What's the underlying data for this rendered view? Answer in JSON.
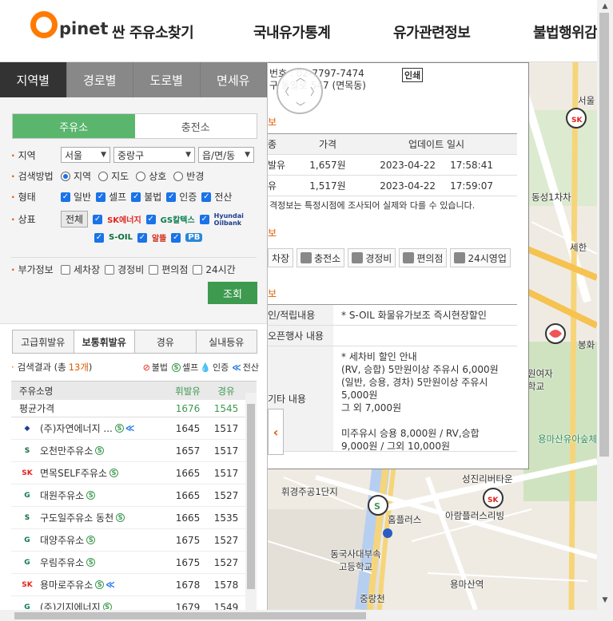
{
  "header": {
    "logo_letter": "O",
    "logo_text": "pinet",
    "nav": [
      "싼 주유소찾기",
      "국내유가통계",
      "유가관련정보",
      "불법행위감"
    ]
  },
  "sidebar": {
    "main_tabs": [
      "지역별",
      "경로별",
      "도로별",
      "면세유"
    ],
    "type_tabs": [
      "주유소",
      "충전소"
    ],
    "filters": {
      "region_label": "지역",
      "region_sido": "서울",
      "region_gu": "중랑구",
      "region_dong": "읍/면/동",
      "method_label": "검색방법",
      "methods": [
        "지역",
        "지도",
        "상호",
        "반경"
      ],
      "form_label": "형태",
      "forms": [
        "일반",
        "셀프",
        "불법",
        "인증",
        "전산"
      ],
      "brand_label": "상표",
      "brand_all": "전체",
      "brands": [
        "SK에너지",
        "GS칼텍스",
        "Hyundai Oilbank",
        "S-OIL",
        "알뜰",
        "PB"
      ],
      "extra_label": "부가정보",
      "extras": [
        "세차장",
        "경정비",
        "편의점",
        "24시간"
      ],
      "search_button": "조회"
    },
    "fuel_tabs": [
      "고급휘발유",
      "보통휘발유",
      "경유",
      "실내등유"
    ],
    "result": {
      "prefix": "검색결과 (총",
      "count": "13개",
      "suffix": ")",
      "legend": [
        "불법",
        "셀프",
        "인증",
        "전산"
      ]
    },
    "list": {
      "headers": [
        "주유소명",
        "휘발유",
        "경유"
      ],
      "average": {
        "name": "평균가격",
        "gasoline": "1676",
        "diesel": "1545"
      },
      "rows": [
        {
          "name": "(주)자연에너지 ...",
          "brand": "hyundai",
          "gasoline": "1645",
          "diesel": "1517"
        },
        {
          "name": "오천만주유소",
          "brand": "soil",
          "gasoline": "1657",
          "diesel": "1517"
        },
        {
          "name": "면목SELF주유소",
          "brand": "sk",
          "gasoline": "1665",
          "diesel": "1517"
        },
        {
          "name": "대원주유소",
          "brand": "gs",
          "gasoline": "1665",
          "diesel": "1527"
        },
        {
          "name": "구도일주유소 동천",
          "brand": "soil",
          "gasoline": "1665",
          "diesel": "1535"
        },
        {
          "name": "대양주유소",
          "brand": "gs",
          "gasoline": "1675",
          "diesel": "1527"
        },
        {
          "name": "우림주유소",
          "brand": "gs",
          "gasoline": "1675",
          "diesel": "1527"
        },
        {
          "name": "용마로주유소",
          "brand": "sk",
          "gasoline": "1678",
          "diesel": "1578"
        },
        {
          "name": "(주)기지에너지",
          "brand": "gs",
          "gasoline": "1679",
          "diesel": "1549"
        }
      ]
    }
  },
  "popup": {
    "phone": "번호 : 02-7797-7474",
    "address": "구 동일로 547 (면목동)",
    "print": "인쇄",
    "price_section": "보",
    "price_headers": [
      "종",
      "가격",
      "업데이트 일시"
    ],
    "prices": [
      {
        "fuel": "발유",
        "price": "1,657원",
        "date": "2023-04-22",
        "time": "17:58:41"
      },
      {
        "fuel": "유",
        "price": "1,517원",
        "date": "2023-04-22",
        "time": "17:59:07"
      }
    ],
    "price_note": "격정보는 특정시점에 조사되어 실제와 다를 수 있습니다.",
    "service_section": "보",
    "services": [
      "차장",
      "충전소",
      "경정비",
      "편의점",
      "24시영업"
    ],
    "extra_section": "보",
    "extra_rows": [
      {
        "k": "인/적립내용",
        "v": "* S-OIL 화물유가보조 즉시현장할인"
      },
      {
        "k": "오픈행사 내용",
        "v": ""
      },
      {
        "k": "기타 내용",
        "v": "* 세차비 할인 안내\n(RV, 승합) 5만원이상 주유시 6,000원\n(일반, 승용, 경차) 5만원이상 주유시 5,000원\n그 외 7,000원\n\n미주유시 승용 8,000원 / RV,승합 9,000원 / 그외 10,000원"
      }
    ]
  },
  "map_labels": [
    "서울",
    "동성1차차",
    "세한",
    "봉화",
    "원여자학교",
    "용마산유아숲체",
    "성진리버타운",
    "아람플러스리빙",
    "휘경주공1단지",
    "홈플러스",
    "동국사대부속고등학교",
    "중랑천",
    "용마산역"
  ],
  "colors": {
    "accent": "#ff7a00",
    "green": "#3d9a4f",
    "dark_tab": "#333333"
  }
}
